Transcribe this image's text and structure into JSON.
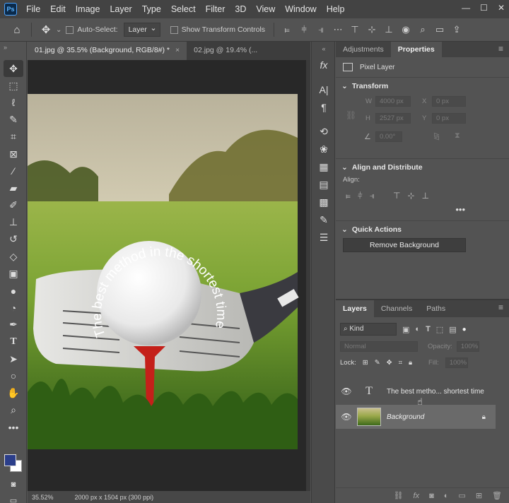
{
  "menubar": {
    "logo": "Ps",
    "items": [
      "File",
      "Edit",
      "Image",
      "Layer",
      "Type",
      "Select",
      "Filter",
      "3D",
      "View",
      "Window",
      "Help"
    ]
  },
  "options": {
    "auto_select_label": "Auto-Select:",
    "auto_select_value": "Layer",
    "transform_controls_label": "Show Transform Controls"
  },
  "tabs": [
    {
      "label": "01.jpg @ 35.5% (Background, RGB/8#) *"
    },
    {
      "label": "02.jpg @ 19.4% (..."
    }
  ],
  "canvas": {
    "curved_text": "The best method in the shortest time"
  },
  "status": {
    "zoom": "35.52%",
    "doc_info": "2000 px x 1504 px (300 ppi)"
  },
  "properties": {
    "tabs": [
      "Adjustments",
      "Properties"
    ],
    "layer_type": "Pixel Layer",
    "transform_title": "Transform",
    "w_label": "W",
    "w_value": "4000 px",
    "h_label": "H",
    "h_value": "2527 px",
    "x_label": "X",
    "x_value": "0 px",
    "y_label": "Y",
    "y_value": "0 px",
    "angle_value": "0.00°",
    "align_title": "Align and Distribute",
    "align_label": "Align:",
    "quick_actions_title": "Quick Actions",
    "remove_bg_label": "Remove Background"
  },
  "layers": {
    "tabs": [
      "Layers",
      "Channels",
      "Paths"
    ],
    "kind_label": "Kind",
    "blend_mode": "Normal",
    "opacity_label": "Opacity:",
    "opacity_value": "100%",
    "lock_label": "Lock:",
    "fill_label": "Fill:",
    "fill_value": "100%",
    "items": [
      {
        "name": "The best metho... shortest time",
        "type": "text"
      },
      {
        "name": "Background",
        "type": "pixel"
      }
    ]
  },
  "colors": {
    "foreground": "#2b3e8a",
    "background": "#ffffff",
    "panel": "#535353",
    "menubar": "#434343"
  }
}
